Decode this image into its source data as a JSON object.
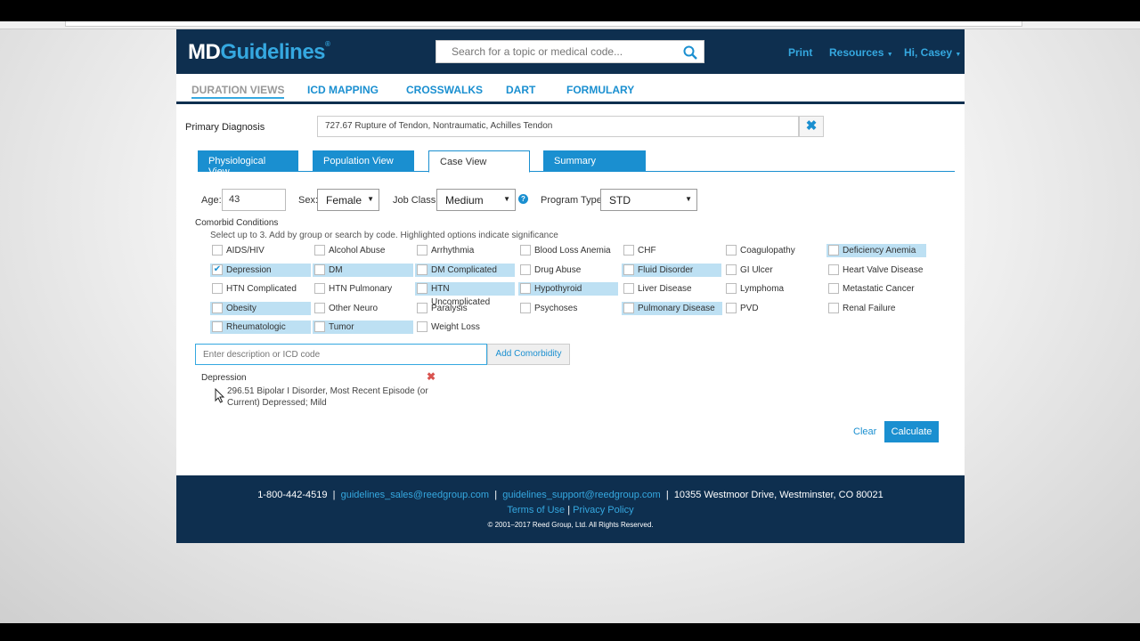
{
  "header": {
    "logo_md": "MD",
    "logo_guidelines": "Guidelines",
    "logo_reg": "®",
    "search_placeholder": "Search for a topic or medical code...",
    "print": "Print",
    "resources": "Resources",
    "user": "Hi, Casey"
  },
  "nav": {
    "duration_views": "DURATION VIEWS",
    "icd_mapping": "ICD MAPPING",
    "crosswalks": "CROSSWALKS",
    "dart": "DART",
    "formulary": "FORMULARY"
  },
  "primary_diagnosis": {
    "label": "Primary Diagnosis",
    "value": "727.67 Rupture of Tendon, Nontraumatic, Achilles Tendon",
    "clear": "✖"
  },
  "tabs": {
    "physiological": "Physiological View",
    "population": "Population View",
    "case": "Case View",
    "summary": "Summary"
  },
  "filters": {
    "age_label": "Age:",
    "age_value": "43",
    "sex_label": "Sex:",
    "sex_value": "Female",
    "job_class_label": "Job Class:",
    "job_class_value": "Medium",
    "program_type_label": "Program Type:",
    "program_type_value": "STD",
    "help": "?"
  },
  "comorbid": {
    "title": "Comorbid Conditions",
    "hint": "Select up to 3. Add by group or search by code. Highlighted options indicate significance",
    "items": [
      {
        "label": "AIDS/HIV",
        "checked": false,
        "highlight": false
      },
      {
        "label": "Alcohol Abuse",
        "checked": false,
        "highlight": false
      },
      {
        "label": "Arrhythmia",
        "checked": false,
        "highlight": false
      },
      {
        "label": "Blood Loss Anemia",
        "checked": false,
        "highlight": false
      },
      {
        "label": "CHF",
        "checked": false,
        "highlight": false
      },
      {
        "label": "Coagulopathy",
        "checked": false,
        "highlight": false
      },
      {
        "label": "Deficiency Anemia",
        "checked": false,
        "highlight": true
      },
      {
        "label": "Depression",
        "checked": true,
        "highlight": true
      },
      {
        "label": "DM",
        "checked": false,
        "highlight": true
      },
      {
        "label": "DM Complicated",
        "checked": false,
        "highlight": true
      },
      {
        "label": "Drug Abuse",
        "checked": false,
        "highlight": false
      },
      {
        "label": "Fluid Disorder",
        "checked": false,
        "highlight": true
      },
      {
        "label": "GI Ulcer",
        "checked": false,
        "highlight": false
      },
      {
        "label": "Heart Valve Disease",
        "checked": false,
        "highlight": false
      },
      {
        "label": "HTN Complicated",
        "checked": false,
        "highlight": false
      },
      {
        "label": "HTN Pulmonary",
        "checked": false,
        "highlight": false
      },
      {
        "label": "HTN Uncomplicated",
        "checked": false,
        "highlight": true
      },
      {
        "label": "Hypothyroid",
        "checked": false,
        "highlight": true
      },
      {
        "label": "Liver Disease",
        "checked": false,
        "highlight": false
      },
      {
        "label": "Lymphoma",
        "checked": false,
        "highlight": false
      },
      {
        "label": "Metastatic Cancer",
        "checked": false,
        "highlight": false
      },
      {
        "label": "Obesity",
        "checked": false,
        "highlight": true
      },
      {
        "label": "Other Neuro",
        "checked": false,
        "highlight": false
      },
      {
        "label": "Paralysis",
        "checked": false,
        "highlight": false
      },
      {
        "label": "Psychoses",
        "checked": false,
        "highlight": false
      },
      {
        "label": "Pulmonary Disease",
        "checked": false,
        "highlight": true
      },
      {
        "label": "PVD",
        "checked": false,
        "highlight": false
      },
      {
        "label": "Renal Failure",
        "checked": false,
        "highlight": false
      },
      {
        "label": "Rheumatologic",
        "checked": false,
        "highlight": true
      },
      {
        "label": "Tumor",
        "checked": false,
        "highlight": true
      },
      {
        "label": "Weight Loss",
        "checked": false,
        "highlight": false
      }
    ],
    "add_placeholder": "Enter description or ICD code",
    "add_button": "Add Comorbidity"
  },
  "selected": {
    "group": "Depression",
    "remove": "✖",
    "item": "296.51 Bipolar I Disorder, Most Recent Episode (or Current) Depressed; Mild"
  },
  "actions": {
    "clear": "Clear",
    "calculate": "Calculate"
  },
  "footer": {
    "phone": "1-800-442-4519",
    "sales_email": "guidelines_sales@reedgroup.com",
    "support_email": "guidelines_support@reedgroup.com",
    "address": "10355 Westmoor Drive, Westminster, CO 80021",
    "terms": "Terms of Use",
    "privacy": "Privacy Policy",
    "copyright": "© 2001–2017 Reed Group, Ltd. All Rights Reserved.",
    "sep": "|"
  },
  "colors": {
    "navy": "#0e2f4f",
    "accent": "#1a8fd0",
    "highlight": "#bde0f3"
  }
}
